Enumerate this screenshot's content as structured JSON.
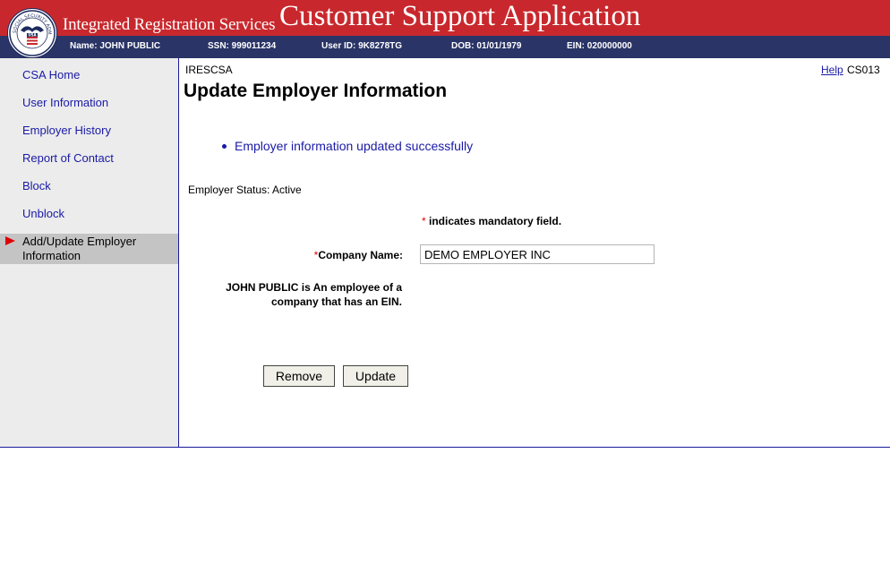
{
  "header": {
    "system_title": "Integrated Registration Services",
    "app_title": "Customer Support Application",
    "seal_text": "SOCIAL SECURITY ADMINISTRATION",
    "seal_usa": "USA"
  },
  "user_bar": {
    "name": "Name: JOHN PUBLIC",
    "ssn": "SSN: 999011234",
    "user_id": "User ID: 9K8278TG",
    "dob": "DOB: 01/01/1979",
    "ein": "EIN: 020000000"
  },
  "sidebar": {
    "items": [
      {
        "label": "CSA Home"
      },
      {
        "label": "User Information"
      },
      {
        "label": "Employer History"
      },
      {
        "label": "Report of Contact"
      },
      {
        "label": "Block"
      },
      {
        "label": "Unblock"
      }
    ],
    "active_item": "Add/Update Employer Information"
  },
  "main": {
    "app_code": "IRESCSA",
    "help_label": "Help",
    "screen_code": "CS013",
    "title": "Update Employer Information",
    "success_message": "Employer information updated successfully",
    "employer_status": "Employer Status: Active",
    "mandatory_star": "*",
    "mandatory_text": " indicates mandatory field.",
    "company_name_label": "Company Name:",
    "company_name_value": "DEMO EMPLOYER INC",
    "employee_note": "JOHN PUBLIC is An employee of a company that has an EIN.",
    "remove_label": "Remove",
    "update_label": "Update"
  },
  "colors": {
    "banner_red": "#c8282d",
    "infobar_navy": "#2a3466",
    "link_blue": "#1a1aa6",
    "required_red": "#e00000"
  }
}
